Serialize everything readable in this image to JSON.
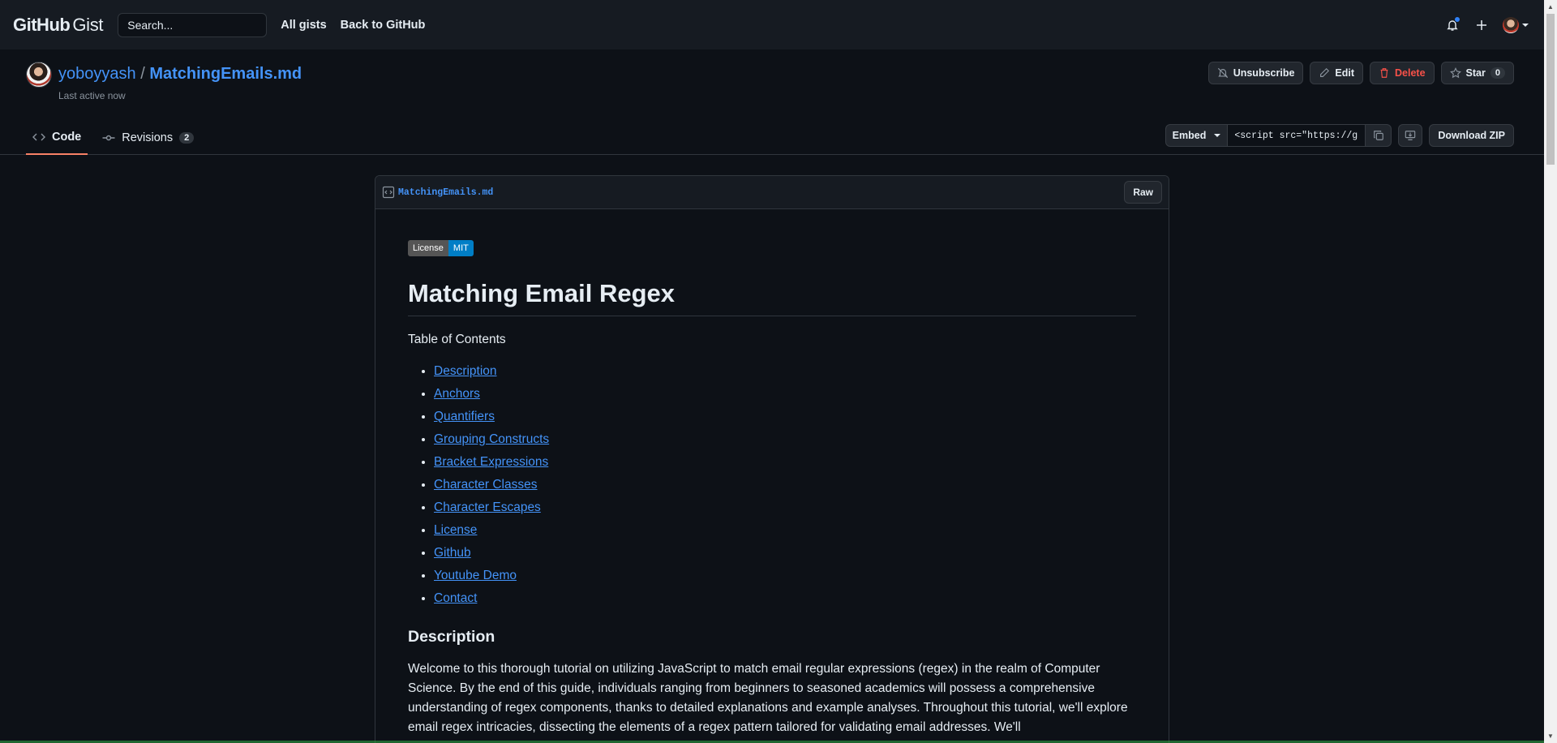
{
  "header": {
    "logo_github": "GitHub",
    "logo_gist": "Gist",
    "search_placeholder": "Search...",
    "nav": [
      "All gists",
      "Back to GitHub"
    ]
  },
  "gist": {
    "owner": "yoboyyash",
    "separator": "/",
    "filename": "MatchingEmails.md",
    "last_active": "Last active now",
    "actions": {
      "unsubscribe": "Unsubscribe",
      "edit": "Edit",
      "delete": "Delete",
      "star": "Star",
      "star_count": "0"
    },
    "tabs": {
      "code": "Code",
      "revisions": "Revisions",
      "revisions_count": "2"
    },
    "embed": {
      "label": "Embed",
      "value": "<script src=\"https://g",
      "download": "Download ZIP"
    }
  },
  "file": {
    "name": "MatchingEmails.md",
    "raw": "Raw"
  },
  "markdown": {
    "badge_left": "License",
    "badge_right": "MIT",
    "h1": "Matching Email Regex",
    "toc_title": "Table of Contents",
    "toc": [
      "Description",
      "Anchors",
      "Quantifiers",
      "Grouping Constructs",
      "Bracket Expressions",
      "Character Classes",
      "Character Escapes",
      "License",
      "Github",
      "Youtube Demo",
      "Contact"
    ],
    "h2": "Description",
    "paragraph": "Welcome to this thorough tutorial on utilizing JavaScript to match email regular expressions (regex) in the realm of Computer Science. By the end of this guide, individuals ranging from beginners to seasoned academics will possess a comprehensive understanding of regex components, thanks to detailed explanations and example analyses. Throughout this tutorial, we'll explore email regex intricacies, dissecting the elements of a regex pattern tailored for validating email addresses. We'll"
  },
  "colors": {
    "accent_link": "#4493f8",
    "tab_underline": "#f78166",
    "danger": "#f85149",
    "badge_mit": "#007ec6"
  }
}
